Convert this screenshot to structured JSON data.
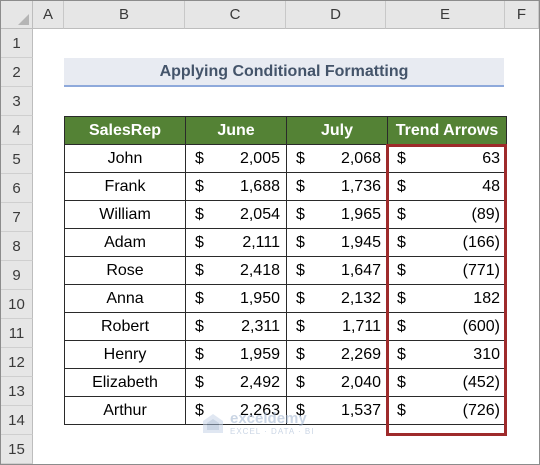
{
  "columns": [
    "A",
    "B",
    "C",
    "D",
    "E",
    "F"
  ],
  "rows": [
    "1",
    "2",
    "3",
    "4",
    "5",
    "6",
    "7",
    "8",
    "9",
    "10",
    "11",
    "12",
    "13",
    "14",
    "15"
  ],
  "title": "Applying Conditional Formatting",
  "headers": [
    "SalesRep",
    "June",
    "July",
    "Trend Arrows"
  ],
  "currency_symbol": "$",
  "records": [
    {
      "name": "John",
      "june": "2,005",
      "july": "2,068",
      "trend": "63"
    },
    {
      "name": "Frank",
      "june": "1,688",
      "july": "1,736",
      "trend": "48"
    },
    {
      "name": "William",
      "june": "2,054",
      "july": "1,965",
      "trend": "(89)"
    },
    {
      "name": "Adam",
      "june": "2,111",
      "july": "1,945",
      "trend": "(166)"
    },
    {
      "name": "Rose",
      "june": "2,418",
      "july": "1,647",
      "trend": "(771)"
    },
    {
      "name": "Anna",
      "june": "1,950",
      "july": "2,132",
      "trend": "182"
    },
    {
      "name": "Robert",
      "june": "2,311",
      "july": "1,711",
      "trend": "(600)"
    },
    {
      "name": "Henry",
      "june": "1,959",
      "july": "2,269",
      "trend": "310"
    },
    {
      "name": "Elizabeth",
      "june": "2,492",
      "july": "2,040",
      "trend": "(452)"
    },
    {
      "name": "Arthur",
      "june": "2,263",
      "july": "1,537",
      "trend": "(726)"
    }
  ],
  "watermark": {
    "brand": "exceldemy",
    "tagline": "EXCEL · DATA · BI"
  },
  "colors": {
    "header_green": "#548235",
    "highlight_border": "#9e2a2b",
    "title_text": "#44546a",
    "title_underline": "#8ea9db"
  }
}
